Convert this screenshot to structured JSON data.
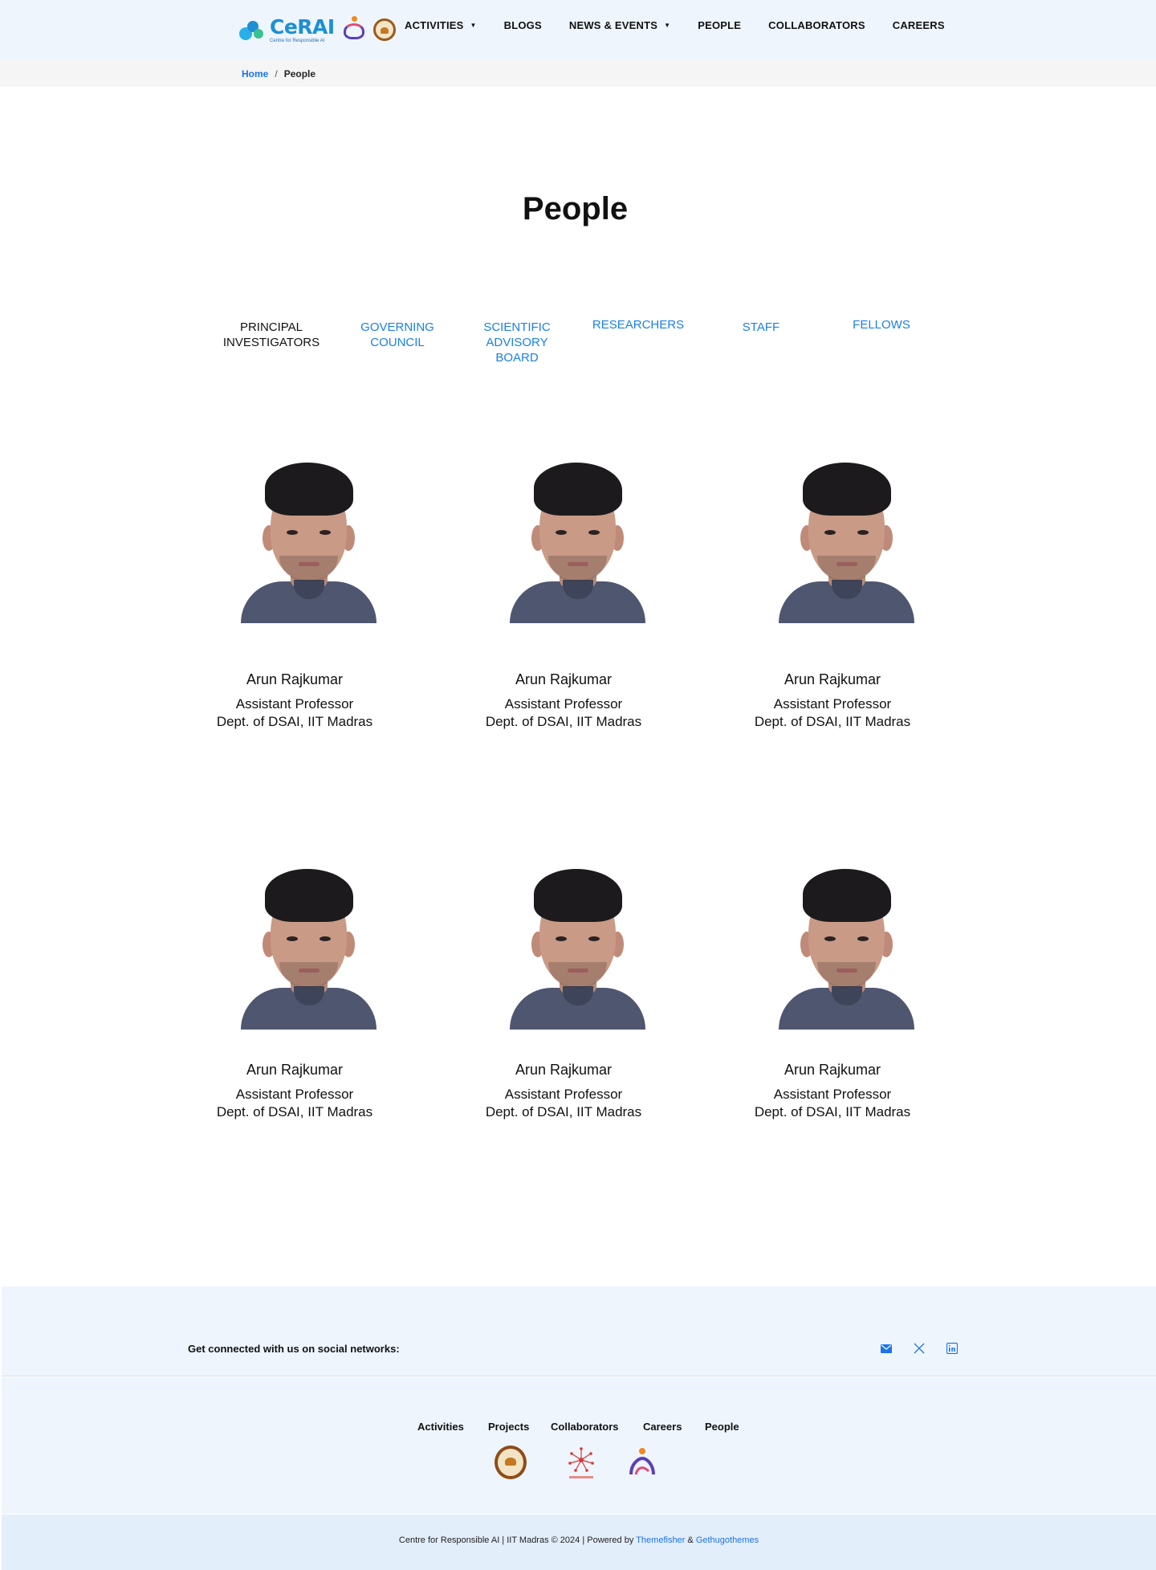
{
  "header": {
    "logo": {
      "title": "CeRAI",
      "subtitle": "Centre for Responsible AI"
    },
    "nav": [
      {
        "label": "ACTIVITIES",
        "dropdown": true
      },
      {
        "label": "BLOGS",
        "dropdown": false
      },
      {
        "label": "NEWS & EVENTS",
        "dropdown": true
      },
      {
        "label": "PEOPLE",
        "dropdown": false
      },
      {
        "label": "COLLABORATORS",
        "dropdown": false
      },
      {
        "label": "CAREERS",
        "dropdown": false
      }
    ]
  },
  "breadcrumb": {
    "home": "Home",
    "separator": "/",
    "current": "People"
  },
  "page_title": "People",
  "tabs": [
    {
      "label": "PRINCIPAL INVESTIGATORS",
      "active": true
    },
    {
      "label": "GOVERNING COUNCIL",
      "active": false
    },
    {
      "label": "SCIENTIFIC ADVISORY BOARD",
      "active": false
    },
    {
      "label": "RESEARCHERS",
      "active": false
    },
    {
      "label": "STAFF",
      "active": false
    },
    {
      "label": "FELLOWS",
      "active": false
    }
  ],
  "people": [
    {
      "name": "Arun Rajkumar",
      "title": "Assistant Professor",
      "dept": "Dept. of DSAI, IIT Madras"
    },
    {
      "name": "Arun Rajkumar",
      "title": "Assistant Professor",
      "dept": "Dept. of DSAI, IIT Madras"
    },
    {
      "name": "Arun Rajkumar",
      "title": "Assistant Professor",
      "dept": "Dept. of DSAI, IIT Madras"
    },
    {
      "name": "Arun Rajkumar",
      "title": "Assistant Professor",
      "dept": "Dept. of DSAI, IIT Madras"
    },
    {
      "name": "Arun Rajkumar",
      "title": "Assistant Professor",
      "dept": "Dept. of DSAI, IIT Madras"
    },
    {
      "name": "Arun Rajkumar",
      "title": "Assistant Professor",
      "dept": "Dept. of DSAI, IIT Madras"
    }
  ],
  "footer": {
    "social_text": "Get connected with us on social networks:",
    "social_icons": [
      "email-icon",
      "x-twitter-icon",
      "linkedin-icon"
    ],
    "links": [
      "Activities",
      "Projects",
      "Collaborators",
      "Careers",
      "People"
    ],
    "copyright_prefix": "Centre for Responsible AI | IIT Madras © 2024 | Powered by",
    "powered_by_1": "Themefisher",
    "amp": "&",
    "powered_by_2": "Gethugothemes"
  },
  "colors": {
    "accent": "#1a80e5",
    "header_bg": "#eef5fd",
    "footer_bg": "#eef5fd"
  }
}
